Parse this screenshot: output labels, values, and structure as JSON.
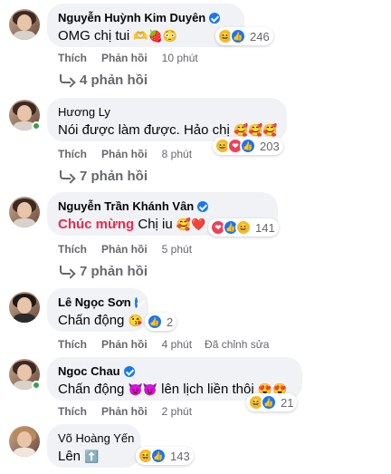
{
  "comments": [
    {
      "author": "Nguyễn Huỳnh Kim Duyên",
      "verified": true,
      "text": "OMG chị tui",
      "text_emojis": "🫶🍓😳",
      "reaction_icons": [
        "haha-icon",
        "like-icon"
      ],
      "reaction_count": "246",
      "like_label": "Thích",
      "reply_label": "Phản hồi",
      "time": "10 phút",
      "replies": "4 phản hồi"
    },
    {
      "author": "Hương Ly",
      "verified": false,
      "text": "Nói được làm được. Hảo chị",
      "text_emojis": "🥰🥰🥰",
      "reaction_icons": [
        "haha-icon",
        "love-icon",
        "like-icon"
      ],
      "reaction_count": "203",
      "like_label": "Thích",
      "reply_label": "Phản hồi",
      "time": "8 phút",
      "replies": "7 phản hồi"
    },
    {
      "author": "Nguyễn Trần Khánh Vân",
      "verified": true,
      "text_highlight": "Chúc mừng",
      "text": "Chị iu",
      "text_emojis": "🥰❤️",
      "reaction_icons": [
        "love-icon",
        "like-icon",
        "haha-icon"
      ],
      "reaction_count": "141",
      "like_label": "Thích",
      "reply_label": "Phản hồi",
      "time": "5 phút",
      "replies": "7 phản hồi"
    },
    {
      "author": "Lê Ngọc Sơn",
      "verified": true,
      "text": "Chấn động",
      "text_emojis": "😘",
      "reaction_icons": [
        "like-icon"
      ],
      "reaction_count": "2",
      "like_label": "Thích",
      "reply_label": "Phản hồi",
      "time": "4 phút",
      "edited": "Đã chỉnh sửa"
    },
    {
      "author": "Ngoc Chau",
      "verified": true,
      "text": "Chấn động",
      "text_emojis_mid": "😈😈",
      "text_after": "lên lịch liền thôi",
      "text_emojis": "😍😍",
      "reaction_icons": [
        "haha-icon",
        "like-icon"
      ],
      "reaction_count": "21",
      "like_label": "Thích",
      "reply_label": "Phản hồi",
      "time": "2 phút"
    },
    {
      "author": "Võ Hoàng Yến",
      "verified": false,
      "text": "Lên",
      "text_emojis": "⬆️",
      "reaction_icons": [
        "haha-icon",
        "like-icon"
      ],
      "reaction_count": "143"
    }
  ],
  "colors": {
    "bubble": "#f0f2f5",
    "meta": "#65676b",
    "like_blue": "#1877f2",
    "haha_yellow": "#f7b928",
    "love_red": "#f33e58",
    "highlight": "#f0284a"
  }
}
